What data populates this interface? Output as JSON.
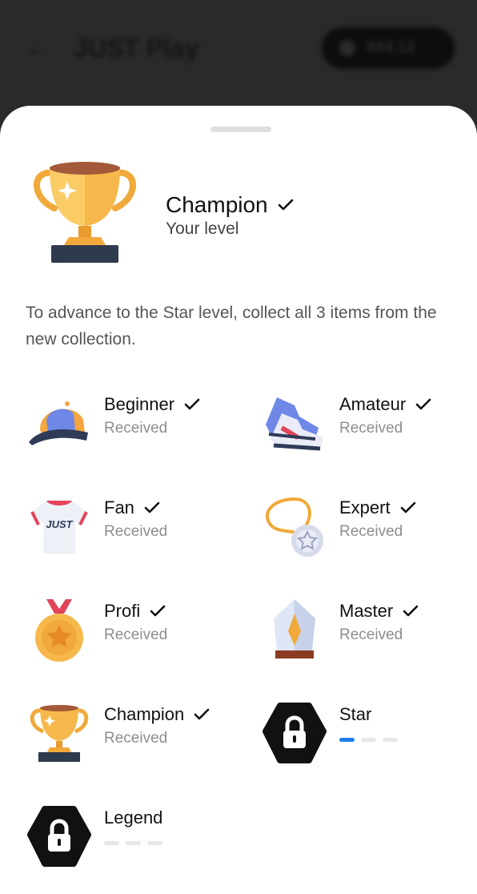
{
  "background": {
    "back_icon": "arrow-left-icon",
    "title": "JUST Play",
    "balance": "884.12"
  },
  "header": {
    "level_name": "Champion",
    "subtitle": "Your level"
  },
  "description": "To advance to the Star level, collect all 3 items from the new collection.",
  "levels": [
    {
      "name": "Beginner",
      "status": "Received",
      "icon": "cap-icon",
      "received": true
    },
    {
      "name": "Amateur",
      "status": "Received",
      "icon": "sneakers-icon",
      "received": true
    },
    {
      "name": "Fan",
      "status": "Received",
      "icon": "jersey-icon",
      "received": true
    },
    {
      "name": "Expert",
      "status": "Received",
      "icon": "medal-lanyard-icon",
      "received": true
    },
    {
      "name": "Profi",
      "status": "Received",
      "icon": "gold-medal-icon",
      "received": true
    },
    {
      "name": "Master",
      "status": "Received",
      "icon": "crystal-award-icon",
      "received": true
    },
    {
      "name": "Champion",
      "status": "Received",
      "icon": "trophy-icon",
      "received": true
    },
    {
      "name": "Star",
      "status": "",
      "icon": "lock-icon",
      "received": false,
      "progress": "1/3"
    },
    {
      "name": "Legend",
      "status": "",
      "icon": "lock-icon",
      "received": false,
      "progress": "0/3"
    }
  ],
  "colors": {
    "progress_active": "#1c7ee6",
    "progress_inactive": "#e7e7e7",
    "lock_bg": "#111111"
  }
}
